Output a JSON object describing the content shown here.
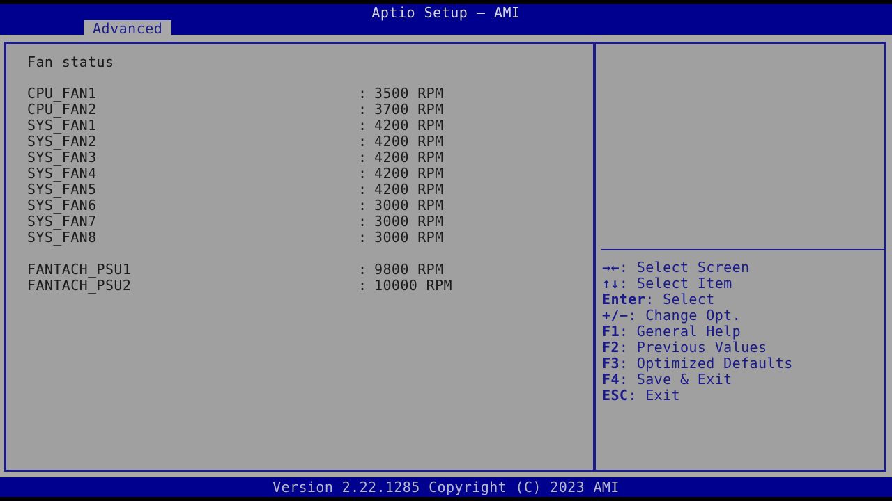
{
  "header": {
    "title": "Aptio Setup – AMI",
    "tabs": [
      {
        "label": "Advanced",
        "active": true
      }
    ]
  },
  "main": {
    "section_title": "Fan status",
    "separator": ":",
    "fans": [
      {
        "name": "CPU_FAN1",
        "value": "3500 RPM",
        "rpm": 3500
      },
      {
        "name": "CPU_FAN2",
        "value": "3700 RPM",
        "rpm": 3700
      },
      {
        "name": "SYS_FAN1",
        "value": "4200 RPM",
        "rpm": 4200
      },
      {
        "name": "SYS_FAN2",
        "value": "4200 RPM",
        "rpm": 4200
      },
      {
        "name": "SYS_FAN3",
        "value": "4200 RPM",
        "rpm": 4200
      },
      {
        "name": "SYS_FAN4",
        "value": "4200 RPM",
        "rpm": 4200
      },
      {
        "name": "SYS_FAN5",
        "value": "4200 RPM",
        "rpm": 4200
      },
      {
        "name": "SYS_FAN6",
        "value": "3000 RPM",
        "rpm": 3000
      },
      {
        "name": "SYS_FAN7",
        "value": "3000 RPM",
        "rpm": 3000
      },
      {
        "name": "SYS_FAN8",
        "value": "3000 RPM",
        "rpm": 3000
      },
      {
        "name": "",
        "value": "",
        "rpm": null
      },
      {
        "name": "FANTACH_PSU1",
        "value": "9800 RPM",
        "rpm": 9800
      },
      {
        "name": "FANTACH_PSU2",
        "value": "10000 RPM",
        "rpm": 10000
      }
    ]
  },
  "help": {
    "items": [
      {
        "key": "→←",
        "label": ": Select Screen"
      },
      {
        "key": "↑↓",
        "label": ": Select Item"
      },
      {
        "key": "Enter",
        "label": ": Select"
      },
      {
        "key": "+/−",
        "label": ": Change Opt."
      },
      {
        "key": "F1",
        "label": ": General Help"
      },
      {
        "key": "F2",
        "label": ": Previous Values"
      },
      {
        "key": "F3",
        "label": ": Optimized Defaults"
      },
      {
        "key": "F4",
        "label": ": Save & Exit"
      },
      {
        "key": "ESC",
        "label": ": Exit"
      }
    ]
  },
  "footer": {
    "version_text": "Version 2.22.1285 Copyright (C) 2023 AMI"
  },
  "colors": {
    "header_blue": "#00008f",
    "panel_gray": "#a0a0a0",
    "body_gray": "#a8a8a8",
    "border_blue": "#1a1a8c",
    "text_dark": "#1c1c1c",
    "help_text": "#1a1a8c",
    "title_text": "#d4d4d4",
    "footer_text": "#b8b8c8",
    "black": "#000000"
  }
}
